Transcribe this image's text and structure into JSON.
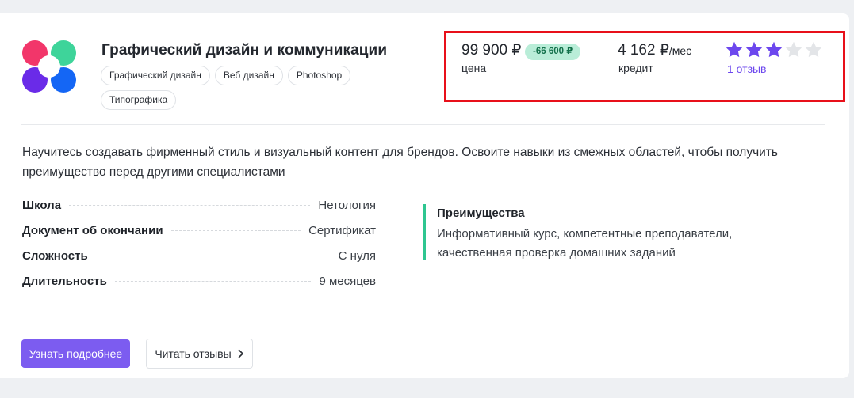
{
  "course": {
    "title": "Графический дизайн и коммуникации",
    "tags": [
      "Графический дизайн",
      "Веб дизайн",
      "Photoshop",
      "Типографика"
    ],
    "logo_colors": [
      "#f2366a",
      "#3ed49a",
      "#6a2be8",
      "#1466f5"
    ]
  },
  "pricing": {
    "price": "99 900 ₽",
    "discount": "-66 600 ₽",
    "price_label": "цена",
    "credit": "4 162 ₽",
    "credit_unit": "/мес",
    "credit_label": "кредит",
    "rating": 3,
    "rating_max": 5,
    "reviews_link": "1 отзыв",
    "highlight_color": "#e8101a"
  },
  "description": "Научитесь создавать фирменный стиль и визуальный контент для брендов. Освоите навыки из смежных областей, чтобы получить преимущество перед другими специалистами",
  "facts": [
    {
      "key": "Школа",
      "value": "Нетология"
    },
    {
      "key": "Документ об окончании",
      "value": "Сертификат"
    },
    {
      "key": "Сложность",
      "value": "С нуля"
    },
    {
      "key": "Длительность",
      "value": "9 месяцев"
    }
  ],
  "advantages": {
    "title": "Преимущества",
    "text": "Информативный курс, компетентные преподаватели, качественная проверка домашних заданий"
  },
  "actions": {
    "primary_label": "Узнать подробнее",
    "secondary_label": "Читать отзывы",
    "secondary_icon": "chevron-right-icon"
  },
  "colors": {
    "accent": "#7c5cf0",
    "star_filled": "#6c47ee",
    "star_empty": "#e3e5e8",
    "advantage_border": "#2ec690"
  }
}
